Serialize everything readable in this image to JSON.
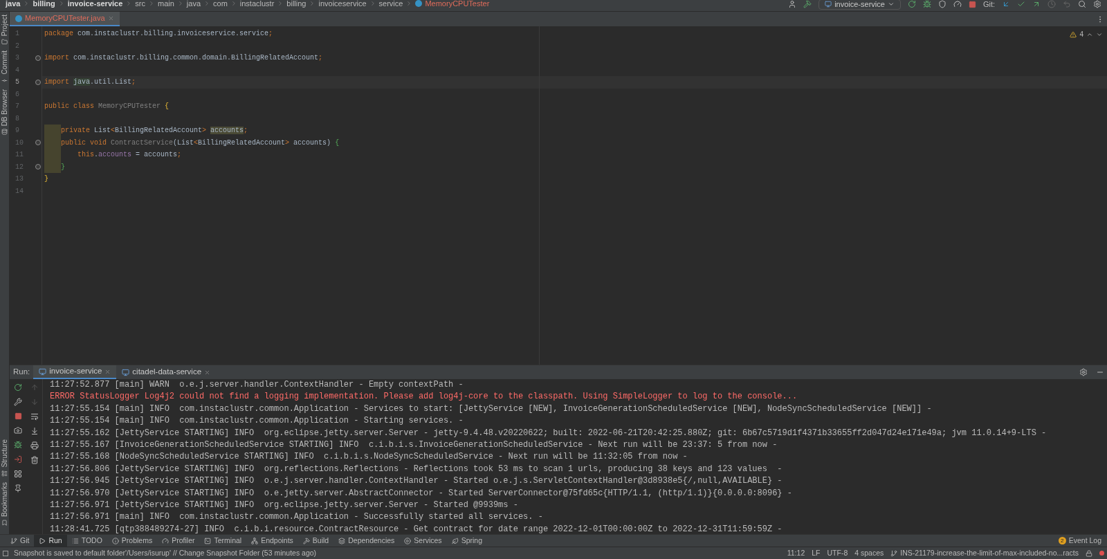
{
  "breadcrumb": [
    {
      "label": "java",
      "kind": "module"
    },
    {
      "label": "billing",
      "kind": "module"
    },
    {
      "label": "invoice-service",
      "kind": "module"
    },
    {
      "label": "src",
      "kind": "folder"
    },
    {
      "label": "main",
      "kind": "folder"
    },
    {
      "label": "java",
      "kind": "folder"
    },
    {
      "label": "com",
      "kind": "folder"
    },
    {
      "label": "instaclustr",
      "kind": "folder"
    },
    {
      "label": "billing",
      "kind": "folder"
    },
    {
      "label": "invoiceservice",
      "kind": "folder"
    },
    {
      "label": "service",
      "kind": "folder"
    },
    {
      "label": "MemoryCPUTester",
      "kind": "class"
    }
  ],
  "toolbar": {
    "run_config": "invoice-service",
    "git_label": "Git:"
  },
  "side_left_top": [
    "Project",
    "Commit",
    "DB Browser"
  ],
  "side_left_bottom": [
    "Structure",
    "Bookmarks"
  ],
  "editor_tabs": [
    {
      "label": "MemoryCPUTester.java",
      "selected": true
    }
  ],
  "warnings": "4",
  "code": [
    {
      "number": "1",
      "current": false,
      "fold": false,
      "scope": false,
      "tokens": [
        {
          "text": "package ",
          "kind": "kw"
        },
        {
          "text": "com.instaclustr.billing.invoiceservice.service",
          "kind": "text"
        },
        {
          "text": ";",
          "kind": "kw"
        }
      ]
    },
    {
      "number": "2",
      "current": false,
      "fold": false,
      "scope": false
    },
    {
      "number": "3",
      "current": false,
      "fold": true,
      "scope": false,
      "tokens": [
        {
          "text": "import ",
          "kind": "kw"
        },
        {
          "text": "com.instaclustr.billing.common.domain.BillingRelatedAccount",
          "kind": "text"
        },
        {
          "text": ";",
          "kind": "kw"
        }
      ]
    },
    {
      "number": "4",
      "current": false,
      "fold": false,
      "scope": false
    },
    {
      "number": "5",
      "current": true,
      "fold": true,
      "scope": false,
      "tokens": [
        {
          "text": "import ",
          "kind": "kw"
        },
        {
          "text": "java",
          "kind": "mark"
        },
        {
          "text": ".util.List",
          "kind": "text"
        },
        {
          "text": ";",
          "kind": "kw"
        }
      ]
    },
    {
      "number": "6",
      "current": false,
      "fold": false,
      "scope": false
    },
    {
      "number": "7",
      "current": false,
      "fold": false,
      "scope": false,
      "tokens": [
        {
          "text": "public class ",
          "kind": "kw"
        },
        {
          "text": "MemoryCPUTester ",
          "kind": "unused"
        },
        {
          "text": "{",
          "kind": "brace1"
        }
      ]
    },
    {
      "number": "8",
      "current": false,
      "fold": false,
      "scope": false
    },
    {
      "number": "9",
      "current": false,
      "fold": false,
      "scope": true,
      "tokens": [
        {
          "text": "private ",
          "kind": "kw"
        },
        {
          "text": "List",
          "kind": "text"
        },
        {
          "text": "<",
          "kind": "kw"
        },
        {
          "text": "BillingRelatedAccount",
          "kind": "text"
        },
        {
          "text": "> ",
          "kind": "kw"
        },
        {
          "text": "accounts",
          "kind": "usage"
        },
        {
          "text": ";",
          "kind": "kw"
        }
      ]
    },
    {
      "number": "10",
      "current": false,
      "fold": true,
      "scope": true,
      "tokens": [
        {
          "text": "public void ",
          "kind": "kw"
        },
        {
          "text": "ContractService",
          "kind": "unused"
        },
        {
          "text": "(List",
          "kind": "text"
        },
        {
          "text": "<",
          "kind": "kw"
        },
        {
          "text": "BillingRelatedAccount",
          "kind": "text"
        },
        {
          "text": "> ",
          "kind": "kw"
        },
        {
          "text": "accounts) ",
          "kind": "text"
        },
        {
          "text": "{",
          "kind": "brace2"
        }
      ]
    },
    {
      "number": "11",
      "current": false,
      "fold": false,
      "scope": true,
      "tokens": [
        {
          "text": "    this",
          "kind": "kw"
        },
        {
          "text": ".",
          "kind": "text"
        },
        {
          "text": "accounts",
          "kind": "field"
        },
        {
          "text": " = accounts",
          "kind": "text"
        },
        {
          "text": ";",
          "kind": "kw"
        }
      ]
    },
    {
      "number": "12",
      "current": false,
      "fold": true,
      "scope": true,
      "tokens": [
        {
          "text": "}",
          "kind": "brace2"
        }
      ]
    },
    {
      "number": "13",
      "current": false,
      "fold": false,
      "scope": false,
      "tokens": [
        {
          "text": "}",
          "kind": "brace1"
        }
      ]
    },
    {
      "number": "14",
      "current": false,
      "fold": false,
      "scope": false
    }
  ],
  "run_panel": {
    "title": "Run:",
    "tabs": [
      {
        "label": "invoice-service",
        "selected": true
      },
      {
        "label": "citadel-data-service",
        "selected": false
      }
    ],
    "console": [
      {
        "kind": "info",
        "text": "11:27:52.877 [main] WARN  o.e.j.server.handler.ContextHandler - Empty contextPath -"
      },
      {
        "kind": "error",
        "text": "ERROR StatusLogger Log4j2 could not find a logging implementation. Please add log4j-core to the classpath. Using SimpleLogger to log to the console..."
      },
      {
        "kind": "info",
        "text": "11:27:55.154 [main] INFO  com.instaclustr.common.Application - Services to start: [JettyService [NEW], InvoiceGenerationScheduledService [NEW], NodeSyncScheduledService [NEW]] -"
      },
      {
        "kind": "info",
        "text": "11:27:55.154 [main] INFO  com.instaclustr.common.Application - Starting services. -"
      },
      {
        "kind": "info",
        "text": "11:27:55.162 [JettyService STARTING] INFO  org.eclipse.jetty.server.Server - jetty-9.4.48.v20220622; built: 2022-06-21T20:42:25.880Z; git: 6b67c5719d1f4371b33655ff2d047d24e171e49a; jvm 11.0.14+9-LTS -"
      },
      {
        "kind": "info",
        "text": "11:27:55.167 [InvoiceGenerationScheduledService STARTING] INFO  c.i.b.i.s.InvoiceGenerationScheduledService - Next run will be 23:37: 5 from now -"
      },
      {
        "kind": "info",
        "text": "11:27:55.168 [NodeSyncScheduledService STARTING] INFO  c.i.b.i.s.NodeSyncScheduledService - Next run will be 11:32:05 from now -"
      },
      {
        "kind": "info",
        "text": "11:27:56.806 [JettyService STARTING] INFO  org.reflections.Reflections - Reflections took 53 ms to scan 1 urls, producing 38 keys and 123 values  -"
      },
      {
        "kind": "info",
        "text": "11:27:56.945 [JettyService STARTING] INFO  o.e.j.server.handler.ContextHandler - Started o.e.j.s.ServletContextHandler@3d8938e5{/,null,AVAILABLE} -"
      },
      {
        "kind": "info",
        "text": "11:27:56.970 [JettyService STARTING] INFO  o.e.jetty.server.AbstractConnector - Started ServerConnector@75fd65c{HTTP/1.1, (http/1.1)}{0.0.0.0:8096} -"
      },
      {
        "kind": "info",
        "text": "11:27:56.971 [JettyService STARTING] INFO  org.eclipse.jetty.server.Server - Started @9939ms -"
      },
      {
        "kind": "info",
        "text": "11:27:56.971 [main] INFO  com.instaclustr.common.Application - Successfully started all services. -"
      },
      {
        "kind": "info",
        "text": "11:28:41.725 [qtp388489274-27] INFO  c.i.b.i.resource.ContractResource - Get contract for date range 2022-12-01T00:00:00Z to 2022-12-31T11:59:59Z -"
      }
    ]
  },
  "tool_tabs": [
    {
      "label": "Git",
      "selected": false
    },
    {
      "label": "Run",
      "selected": true
    },
    {
      "label": "TODO",
      "selected": false
    },
    {
      "label": "Problems",
      "selected": false
    },
    {
      "label": "Profiler",
      "selected": false
    },
    {
      "label": "Terminal",
      "selected": false
    },
    {
      "label": "Endpoints",
      "selected": false
    },
    {
      "label": "Build",
      "selected": false
    },
    {
      "label": "Dependencies",
      "selected": false
    },
    {
      "label": "Services",
      "selected": false
    },
    {
      "label": "Spring",
      "selected": false
    }
  ],
  "event_log": {
    "label": "Event Log",
    "count": "2"
  },
  "status_bar": {
    "message": "Snapshot is saved to default folder'/Users/isurup' // Change Snapshot Folder (53 minutes ago)",
    "position": "11:12",
    "line_ending": "LF",
    "encoding": "UTF-8",
    "indent": "4 spaces",
    "branch": "INS-21179-increase-the-limit-of-max-included-no...racts"
  }
}
